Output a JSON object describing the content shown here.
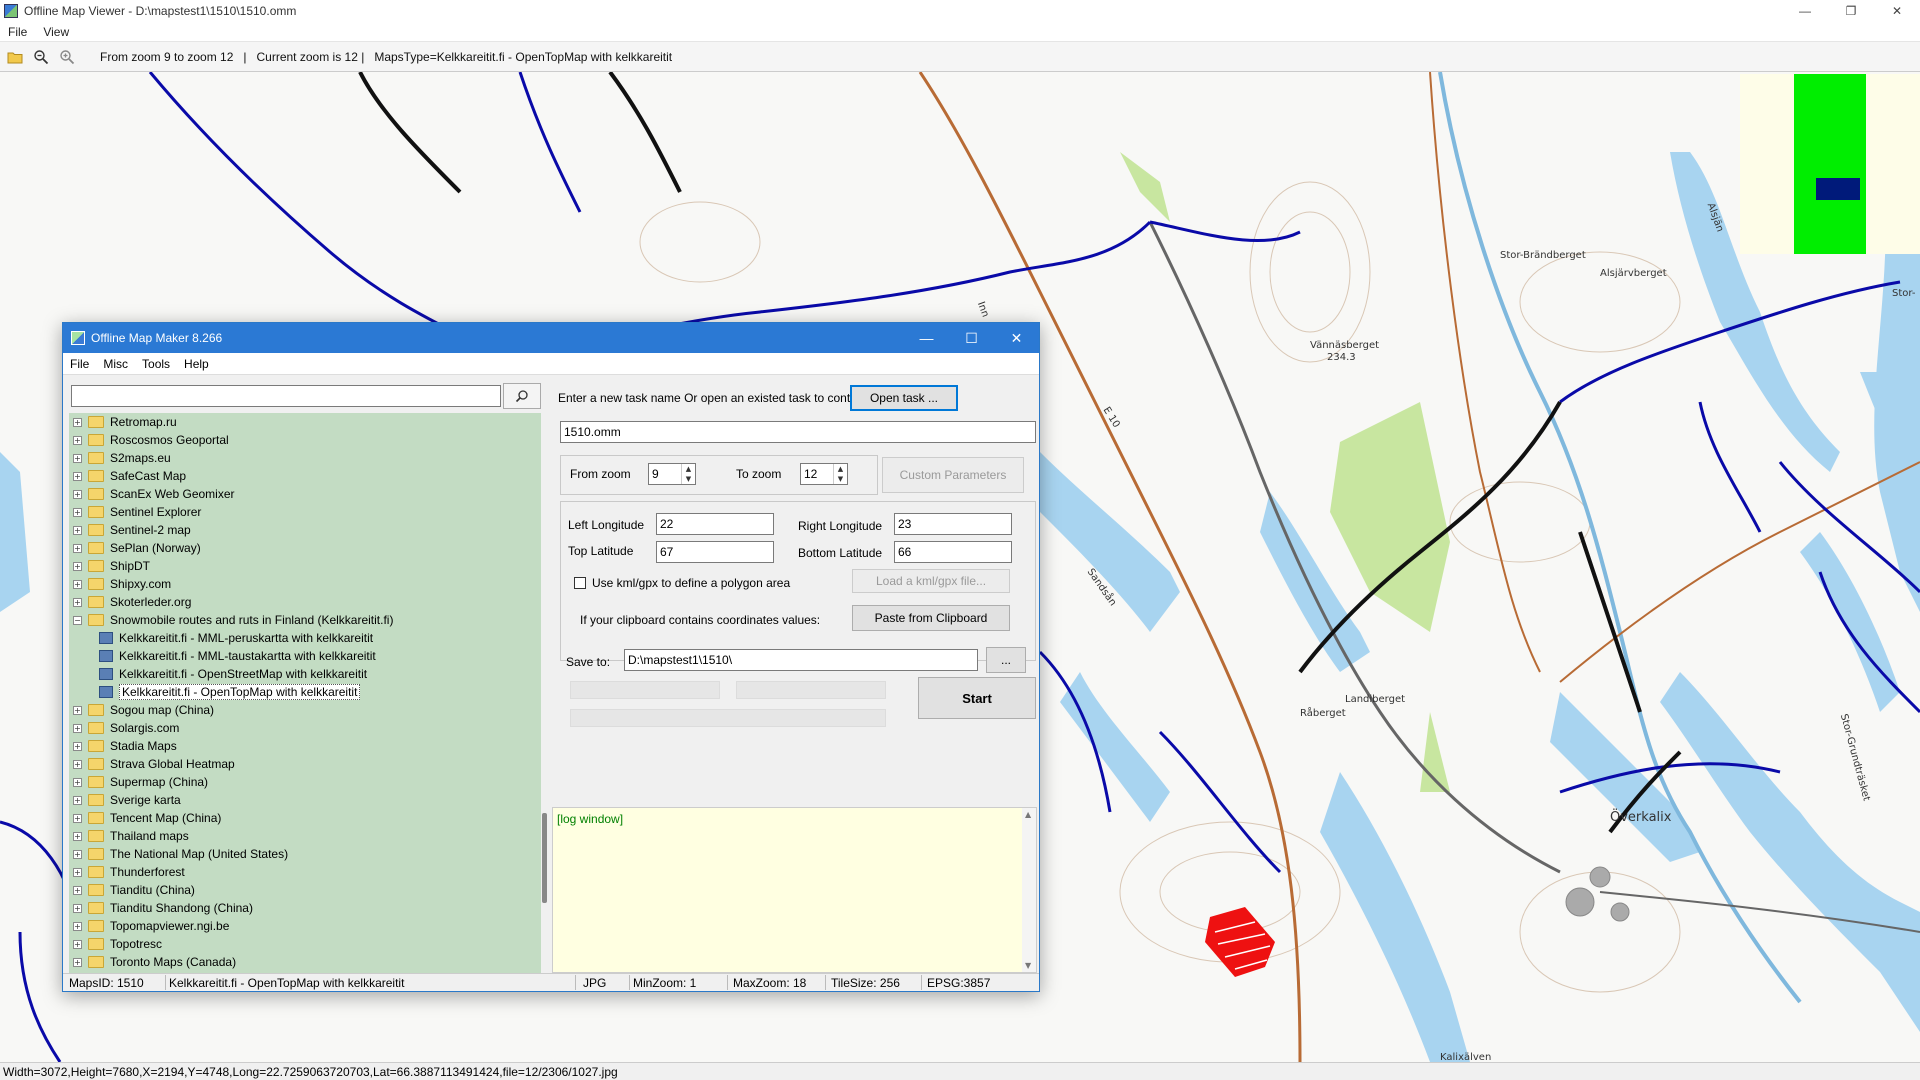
{
  "window": {
    "title": "Offline Map Viewer - D:\\mapstest1\\1510\\1510.omm",
    "controls": [
      "—",
      "❐",
      "✕"
    ]
  },
  "menu": [
    "File",
    "View"
  ],
  "toolbar": {
    "info": "From zoom 9 to zoom 12   |   Current zoom is 12 |   MapsType=Kelkkareitit.fi - OpenTopMap with kelkkareitit"
  },
  "map": {
    "labels": [
      {
        "text": "Stor-Brändberget"
      },
      {
        "text": "Alsjärvberget"
      },
      {
        "text": "Stor-"
      },
      {
        "text": "Alsjän"
      },
      {
        "text": "Vännäsberget"
      },
      {
        "text": "234.3"
      },
      {
        "text": "E 10"
      },
      {
        "text": "Sandsån"
      },
      {
        "text": "Landiberget"
      },
      {
        "text": "Råberget"
      },
      {
        "text": "Överkalix"
      },
      {
        "text": "Stor-Grundträsket"
      },
      {
        "text": "Kalixälven"
      },
      {
        "text": "Inn"
      }
    ],
    "colors": {
      "water": "#a8d4f0",
      "trail": "#0a0aa8",
      "road": "#b86b35",
      "rail": "#666666",
      "park": "#c8e6a0"
    }
  },
  "statusbar": {
    "text": "Width=3072,Height=7680,X=2194,Y=4748,Long=22.7259063720703,Lat=66.3887113491424,file=12/2306/1027.jpg"
  },
  "dialog": {
    "title": "Offline Map Maker 8.266",
    "controls": [
      "—",
      "☐",
      "✕"
    ],
    "menu": [
      "File",
      "Misc",
      "Tools",
      "Help"
    ],
    "search": {
      "value": "",
      "placeholder": ""
    },
    "tree": [
      {
        "label": "Retromap.ru",
        "type": "folder",
        "expanded": false
      },
      {
        "label": "Roscosmos Geoportal",
        "type": "folder",
        "expanded": false
      },
      {
        "label": "S2maps.eu",
        "type": "folder",
        "expanded": false
      },
      {
        "label": "SafeCast Map",
        "type": "folder",
        "expanded": false
      },
      {
        "label": "ScanEx Web Geomixer",
        "type": "folder",
        "expanded": false
      },
      {
        "label": "Sentinel Explorer",
        "type": "folder",
        "expanded": false
      },
      {
        "label": "Sentinel-2 map",
        "type": "folder",
        "expanded": false
      },
      {
        "label": "SePlan (Norway)",
        "type": "folder",
        "expanded": false
      },
      {
        "label": "ShipDT",
        "type": "folder",
        "expanded": false
      },
      {
        "label": "Shipxy.com",
        "type": "folder",
        "expanded": false
      },
      {
        "label": "Skoterleder.org",
        "type": "folder",
        "expanded": false
      },
      {
        "label": "Snowmobile routes and ruts in Finland (Kelkkareitit.fi)",
        "type": "folder",
        "expanded": true
      },
      {
        "label": "Kelkkareitit.fi - MML-peruskartta with kelkkareitit",
        "type": "map"
      },
      {
        "label": "Kelkkareitit.fi - MML-taustakartta with kelkkareitit",
        "type": "map"
      },
      {
        "label": "Kelkkareitit.fi - OpenStreetMap with kelkkareitit",
        "type": "map"
      },
      {
        "label": "Kelkkareitit.fi - OpenTopMap with kelkkareitit",
        "type": "map",
        "selected": true
      },
      {
        "label": "Sogou map (China)",
        "type": "folder",
        "expanded": false
      },
      {
        "label": "Solargis.com",
        "type": "folder",
        "expanded": false
      },
      {
        "label": "Stadia Maps",
        "type": "folder",
        "expanded": false
      },
      {
        "label": "Strava Global Heatmap",
        "type": "folder",
        "expanded": false
      },
      {
        "label": "Supermap (China)",
        "type": "folder",
        "expanded": false
      },
      {
        "label": "Sverige karta",
        "type": "folder",
        "expanded": false
      },
      {
        "label": "Tencent Map (China)",
        "type": "folder",
        "expanded": false
      },
      {
        "label": "Thailand maps",
        "type": "folder",
        "expanded": false
      },
      {
        "label": "The National Map (United States)",
        "type": "folder",
        "expanded": false
      },
      {
        "label": "Thunderforest",
        "type": "folder",
        "expanded": false
      },
      {
        "label": "Tianditu (China)",
        "type": "folder",
        "expanded": false
      },
      {
        "label": "Tianditu Shandong (China)",
        "type": "folder",
        "expanded": false
      },
      {
        "label": "Topomapviewer.ngi.be",
        "type": "folder",
        "expanded": false
      },
      {
        "label": "Topotresc",
        "type": "folder",
        "expanded": false
      },
      {
        "label": "Toronto Maps (Canada)",
        "type": "folder",
        "expanded": false
      }
    ],
    "task": {
      "prompt": "Enter a new task name Or open an existed task to continue:",
      "open_label": "Open task ...",
      "name": "1510.omm"
    },
    "zoom": {
      "from_label": "From zoom",
      "from_value": "9",
      "to_label": "To zoom",
      "to_value": "12",
      "custom_label": "Custom Parameters"
    },
    "coords": {
      "left_lon_label": "Left Longitude",
      "left_lon": "22",
      "right_lon_label": "Right Longitude",
      "right_lon": "23",
      "top_lat_label": "Top Latitude",
      "top_lat": "67",
      "bottom_lat_label": "Bottom Latitude",
      "bottom_lat": "66",
      "kml_label": "Use kml/gpx to define a polygon area",
      "kml_checked": false,
      "load_kml_label": "Load a kml/gpx file...",
      "clipboard_label": "If your clipboard contains coordinates values:",
      "paste_label": "Paste from Clipboard"
    },
    "save": {
      "label": "Save to:",
      "path": "D:\\mapstest1\\1510\\",
      "browse_label": "..."
    },
    "start_label": "Start",
    "log_text": "[log window]",
    "status": {
      "maps_id": "MapsID: 1510",
      "map_name": "Kelkkareitit.fi - OpenTopMap with kelkkareitit",
      "format": "JPG",
      "min_zoom": "MinZoom: 1",
      "max_zoom": "MaxZoom: 18",
      "tile_size": "TileSize: 256",
      "epsg": "EPSG:3857"
    }
  }
}
